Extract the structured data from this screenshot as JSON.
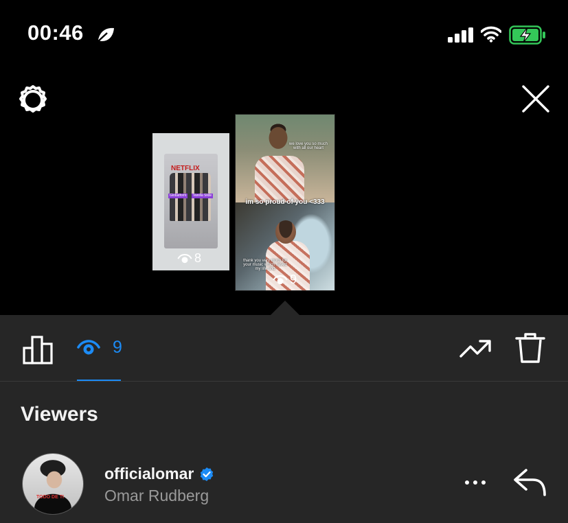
{
  "status_bar": {
    "time": "00:46",
    "leaf_icon": "leaf-icon",
    "signal_icon": "cellular-signal-icon",
    "wifi_icon": "wifi-icon",
    "battery_icon": "battery-charging-icon",
    "battery_color": "#34c759"
  },
  "top_controls": {
    "settings_icon": "gear-icon",
    "close_icon": "close-icon"
  },
  "stories": [
    {
      "view_count": "8",
      "overlay_text": [
        "NETFLIX",
        "Globalform",
        "Vanilla Slide"
      ]
    },
    {
      "view_count": "9",
      "captions": [
        "we love you so much with all our heart",
        "im so proud of you <333",
        "thank you very much for your music which saved my life and"
      ]
    }
  ],
  "tab_bar": {
    "insights_icon": "bar-chart-icon",
    "views_icon": "eye-icon",
    "views_count": "9",
    "promote_icon": "trending-up-icon",
    "delete_icon": "trash-icon",
    "accent_color": "#1c8bf5"
  },
  "viewers": {
    "title": "Viewers",
    "list": [
      {
        "username": "officialomar",
        "full_name": "Omar Rudberg",
        "verified": true,
        "avatar_text": "TODO DE TI",
        "more_icon": "more-dots-icon",
        "reply_icon": "reply-icon"
      }
    ]
  }
}
